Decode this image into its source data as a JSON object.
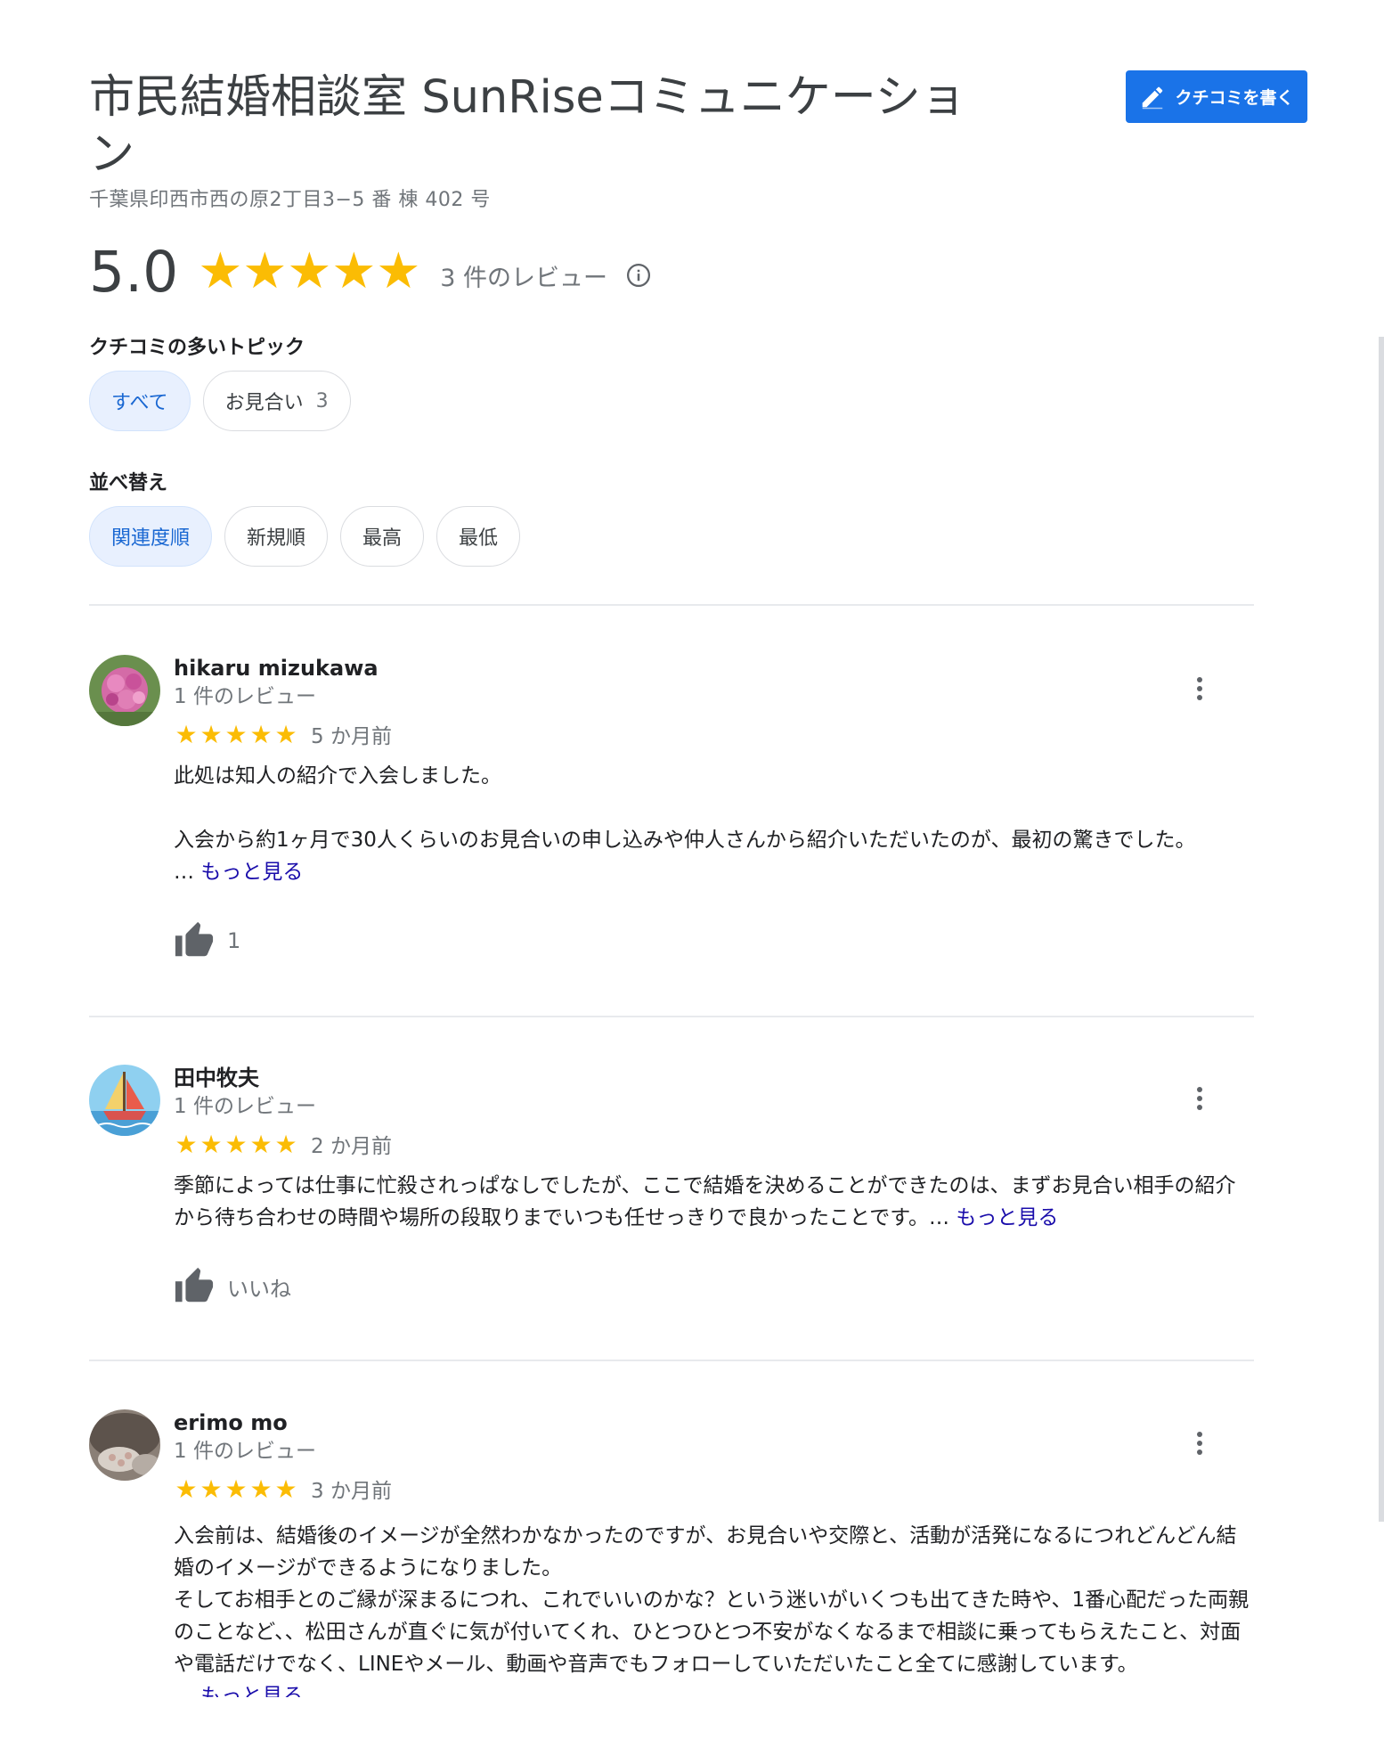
{
  "header": {
    "title": "市民結婚相談室 SunRiseコミュニケーション",
    "address": "千葉県印西市西の原2丁目3−5 番 棟 402 号",
    "write_button": "クチコミを書く"
  },
  "summary": {
    "score": "5.0",
    "stars": 5,
    "count_label": "3 件のレビュー"
  },
  "topics": {
    "label": "クチコミの多いトピック",
    "chips": [
      {
        "label": "すべて",
        "count": "",
        "active": true
      },
      {
        "label": "お見合い",
        "count": "3",
        "active": false
      }
    ]
  },
  "sort": {
    "label": "並べ替え",
    "chips": [
      {
        "label": "関連度順",
        "active": true
      },
      {
        "label": "新規順",
        "active": false
      },
      {
        "label": "最高",
        "active": false
      },
      {
        "label": "最低",
        "active": false
      }
    ]
  },
  "reviews": [
    {
      "name": "hikaru mizukawa",
      "reviews_label": "1 件のレビュー",
      "stars": 5,
      "date": "5 か月前",
      "text": "此処は知人の紹介で入会しました。\n\n入会から約1ヶ月で30人くらいのお見合いの申し込みや仲人さんから紹介いただいたのが、最初の驚きでした。",
      "ellipsis": "…",
      "more": "もっと見る",
      "like_label": "1"
    },
    {
      "name": "田中牧夫",
      "reviews_label": "1 件のレビュー",
      "stars": 5,
      "date": "2 か月前",
      "text": "季節によっては仕事に忙殺されっぱなしでしたが、ここで結婚を決めることができたのは、まずお見合い相手の紹介から待ち合わせの時間や場所の段取りまでいつも任せっきりで良かったことです。",
      "ellipsis": "…",
      "more": "もっと見る",
      "like_label": "いいね"
    },
    {
      "name": "erimo mo",
      "reviews_label": "1 件のレビュー",
      "stars": 5,
      "date": "3 か月前",
      "text": "入会前は、結婚後のイメージが全然わかなかったのですが、お見合いや交際と、活動が活発になるにつれどんどん結婚のイメージができるようになりました。\nそしてお相手とのご縁が深まるにつれ、これでいいのかな？という迷いがいくつも出てきた時や、1番心配だった両親のことなど、、松田さんが直ぐに気が付いてくれ、ひとつひとつ不安がなくなるまで相談に乗ってもらえたこと、対面や電話だけでなく、LINEやメール、動画や音声でもフォローしていただいたこと全てに感謝しています。",
      "ellipsis": "…",
      "more": "もっと見る",
      "like_label": ""
    }
  ]
}
